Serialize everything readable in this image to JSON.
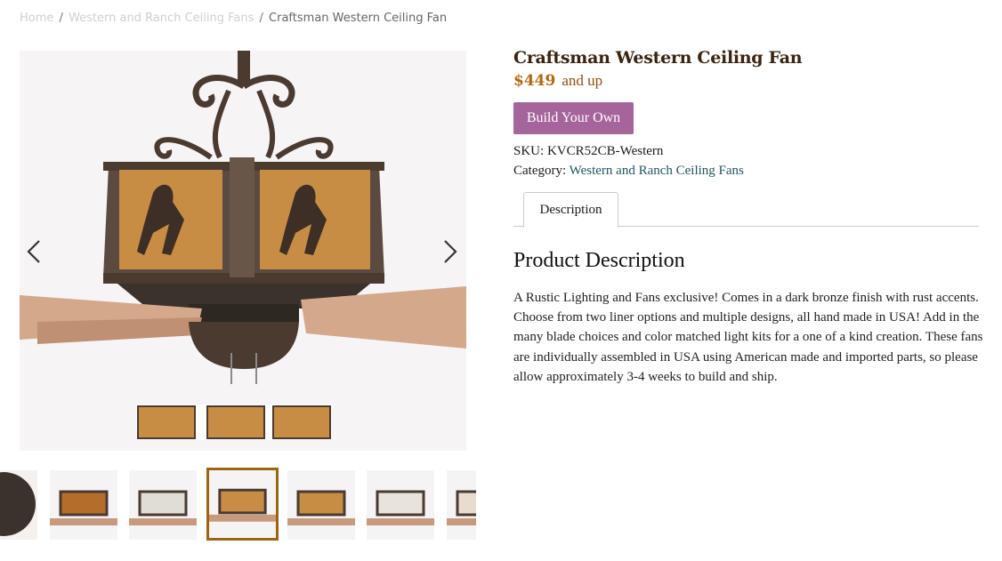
{
  "breadcrumb": {
    "home": "Home",
    "sep1": "/",
    "category": "Western and Ranch Ceiling Fans",
    "sep2": "/",
    "current": "Craftsman Western Ceiling Fan"
  },
  "product": {
    "title": "Craftsman Western Ceiling Fan",
    "price": "$449",
    "price_suffix": "and up",
    "build_button": "Build Your Own",
    "sku_label": "SKU:",
    "sku_value": "KVCR52CB-Western",
    "category_label": "Category:",
    "category_value": "Western and Ranch Ceiling Fans"
  },
  "tabs": {
    "description": "Description"
  },
  "description": {
    "heading": "Product Description",
    "body": "A Rustic Lighting and Fans exclusive! Comes in a dark bronze finish with rust accents. Choose from two liner options and multiple designs, all hand made in USA! Add in the many blade choices and color matched light kits for a one of a kind creation. These fans are individually assembled in USA using American made and imported parts, so please allow approximately 3-4 weeks to build and ship."
  },
  "gallery": {
    "arrow_left_icon": "chevron-left-icon",
    "arrow_right_icon": "chevron-right-icon",
    "thumbnail_count": 7,
    "active_thumbnail": 4
  },
  "colors": {
    "accent_button": "#a5649a",
    "price": "#b06a12",
    "title": "#3a2410",
    "link": "#1f5560",
    "active_thumb_border": "#9a6412"
  }
}
